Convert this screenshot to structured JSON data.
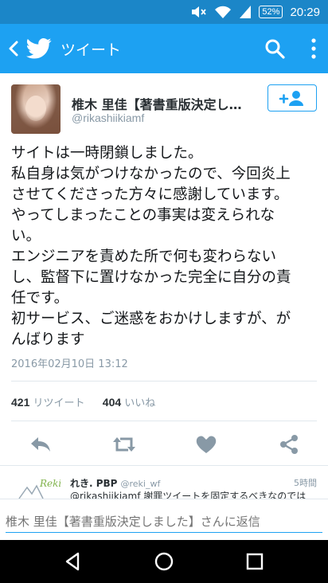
{
  "status_bar": {
    "battery": "52%",
    "time": "20:29",
    "icons": [
      "mute-icon",
      "wifi-icon",
      "signal-icon",
      "battery-icon"
    ]
  },
  "app_bar": {
    "title": "ツイート",
    "color": "#1da1f2"
  },
  "tweet": {
    "user_name": "椎木 里佳【著書重版決定し…",
    "user_handle": "@rikashiikiamf",
    "text_lines": [
      "サイトは一時閉鎖しました。",
      "私自身は気がつけなかったので、今回炎上",
      "させてくださった方々に感謝しています。",
      "やってしまったことの事実は変えられな",
      "い。",
      "エンジニアを責めた所で何も変わらない",
      "し、監督下に置けなかった完全に自分の責",
      "任です。",
      "初サービス、ご迷惑をおかけしますが、が",
      "んばります"
    ],
    "timestamp": "2016年02月10日 13:12",
    "retweet_count": "421",
    "retweet_label": "リツイート",
    "like_count": "404",
    "like_label": "いいね"
  },
  "reply_preview": {
    "name": "れき. PBP",
    "handle": "@reki_wf",
    "time": "5時間",
    "text": "@rikashiikiamf 謝罪ツイートを固定するべきなのでは",
    "avatar_text": "Reki"
  },
  "composer": {
    "placeholder": "椎木 里佳【著書重版決定しました】さんに返信"
  }
}
